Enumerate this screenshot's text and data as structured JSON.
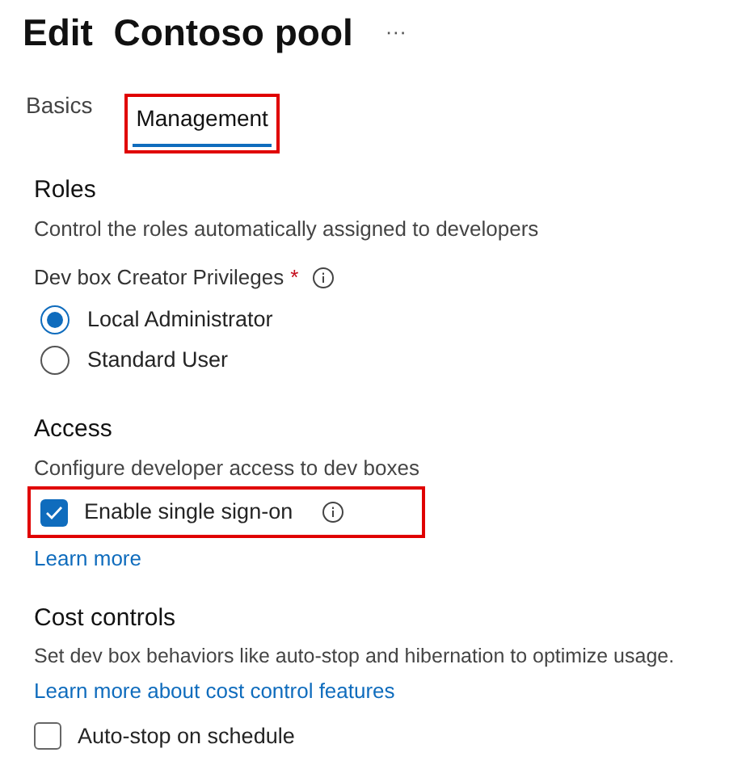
{
  "title": "Edit  Contoso pool",
  "more_menu": "···",
  "tabs": [
    {
      "label": "Basics",
      "selected": false,
      "highlighted": false
    },
    {
      "label": "Management",
      "selected": true,
      "highlighted": true
    }
  ],
  "roles": {
    "heading": "Roles",
    "description": "Control the roles automatically assigned to developers",
    "field_label": "Dev box Creator Privileges",
    "required_mark": "*",
    "options": [
      {
        "label": "Local Administrator",
        "selected": true
      },
      {
        "label": "Standard User",
        "selected": false
      }
    ]
  },
  "access": {
    "heading": "Access",
    "description": "Configure developer access to dev boxes",
    "checkbox": {
      "label": "Enable single sign-on",
      "checked": true,
      "highlighted": true
    },
    "link": "Learn more"
  },
  "cost_controls": {
    "heading": "Cost controls",
    "description": "Set dev box behaviors like auto-stop and hibernation to optimize usage.",
    "link": "Learn more about cost control features",
    "checkbox": {
      "label": "Auto-stop on schedule",
      "checked": false,
      "highlighted": false
    }
  }
}
